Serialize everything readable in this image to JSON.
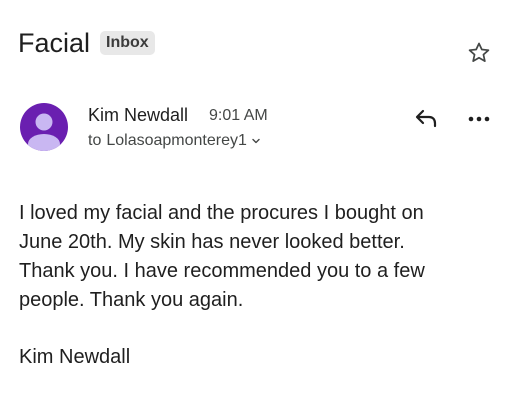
{
  "email": {
    "subject": "Facial",
    "label": "Inbox",
    "sender": {
      "name": "Kim Newdall",
      "time": "9:01 AM",
      "recipient_prefix": "to",
      "recipient": "Lolasoapmonterey1"
    },
    "body_lines": [
      "I loved my facial and the procures I bought on",
      "June 20th. My skin has never looked better.",
      "Thank you. I have recommended you to a few",
      "people. Thank you again."
    ],
    "signature": "Kim Newdall"
  },
  "icons": {
    "star": "star-outline-icon",
    "avatar": "person-icon",
    "expand": "chevron-down-icon",
    "reply": "reply-arrow-icon",
    "more": "more-horizontal-icon"
  },
  "colors": {
    "avatar_bg": "#6a1fb0",
    "avatar_fg": "#c9b7f2",
    "label_chip_bg": "#e8e8e8"
  }
}
